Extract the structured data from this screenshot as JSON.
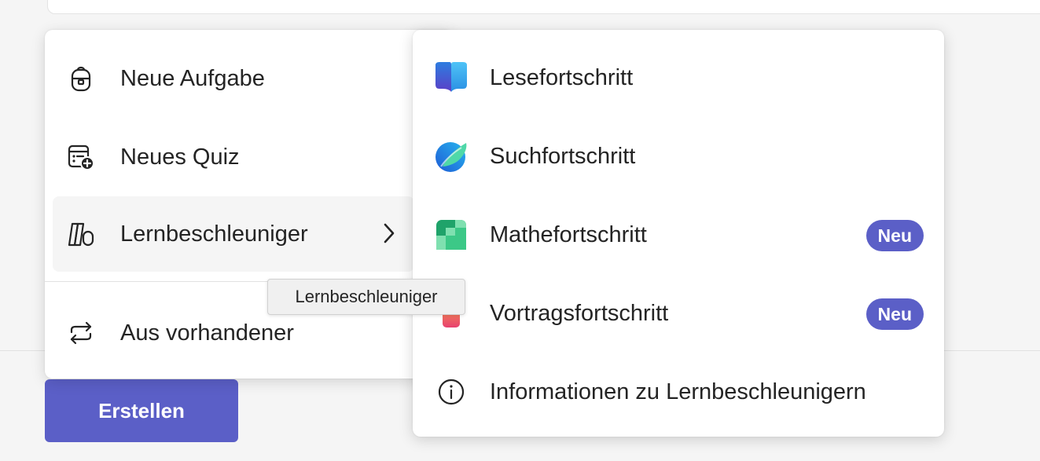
{
  "menu": {
    "items": [
      {
        "label": "Neue Aufgabe",
        "icon": "backpack-icon"
      },
      {
        "label": "Neues Quiz",
        "icon": "quiz-add-icon"
      },
      {
        "label": "Lernbeschleuniger",
        "icon": "books-icon",
        "has_submenu": true
      },
      {
        "label": "Aus vorhandener",
        "icon": "reuse-arrows-icon"
      }
    ]
  },
  "submenu": {
    "items": [
      {
        "label": "Lesefortschritt",
        "icon": "reading-progress-icon"
      },
      {
        "label": "Suchfortschritt",
        "icon": "search-progress-icon"
      },
      {
        "label": "Mathefortschritt",
        "icon": "math-progress-icon",
        "badge": "Neu"
      },
      {
        "label": "Vortragsfortschritt",
        "icon": "speaker-progress-icon",
        "badge": "Neu"
      },
      {
        "label": "Informationen zu Lernbeschleunigern",
        "icon": "info-icon"
      }
    ]
  },
  "tooltip": {
    "text": "Lernbeschleuniger"
  },
  "buttons": {
    "create_label": "Erstellen"
  },
  "colors": {
    "accent": "#5b5fc7",
    "background": "#f5f5f5",
    "menu_bg": "#ffffff",
    "hover_bg": "#f5f5f5"
  }
}
